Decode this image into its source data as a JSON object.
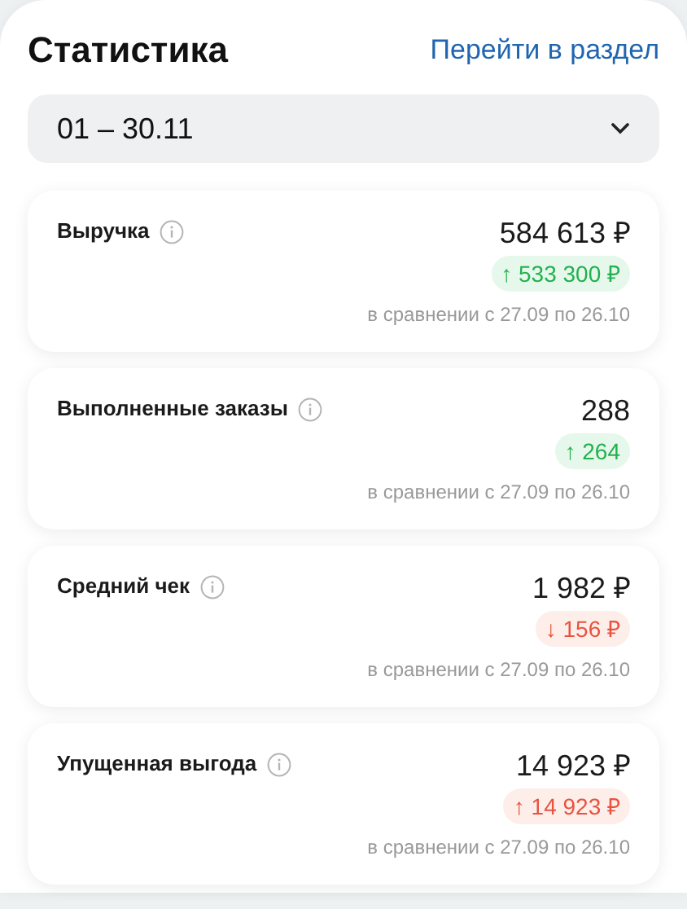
{
  "header": {
    "title": "Статистика",
    "link": "Перейти в раздел"
  },
  "period": {
    "value": "01 – 30.11"
  },
  "metrics": [
    {
      "label": "Выручка",
      "value": "584 613 ₽",
      "delta": "↑ 533 300 ₽",
      "kind": "positive",
      "comparison": "в сравнении с 27.09 по 26.10"
    },
    {
      "label": "Выполненные заказы",
      "value": "288",
      "delta": "↑ 264",
      "kind": "positive",
      "comparison": "в сравнении с 27.09 по 26.10"
    },
    {
      "label": "Средний чек",
      "value": "1 982 ₽",
      "delta": "↓ 156 ₽",
      "kind": "negative",
      "comparison": "в сравнении с 27.09 по 26.10"
    },
    {
      "label": "Упущенная выгода",
      "value": "14 923 ₽",
      "delta": "↑ 14 923 ₽",
      "kind": "negative",
      "comparison": "в сравнении с 27.09 по 26.10"
    }
  ]
}
